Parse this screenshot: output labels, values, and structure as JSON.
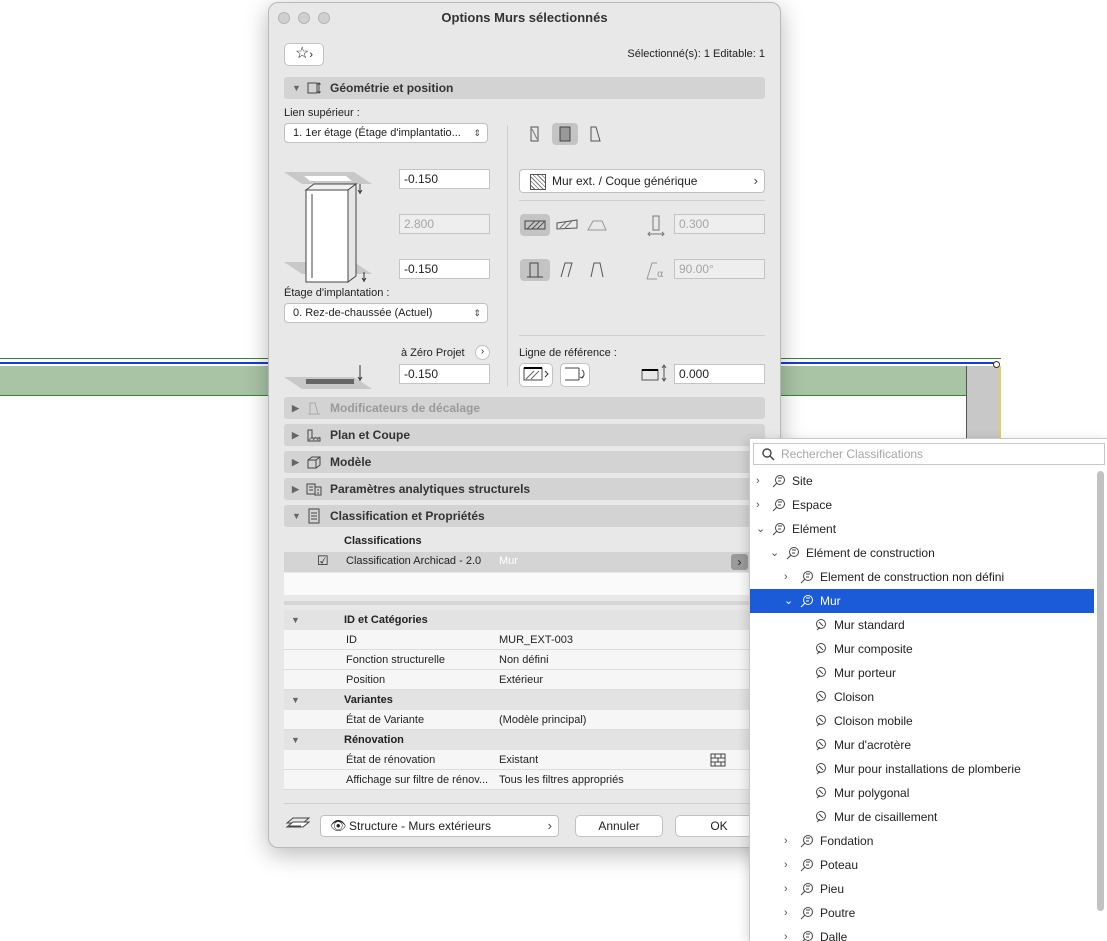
{
  "dialog": {
    "title": "Options Murs sélectionnés",
    "selection_info": "Sélectionné(s): 1 Editable: 1"
  },
  "geometry": {
    "header": "Géométrie et position",
    "top_link_label": "Lien supérieur :",
    "top_link_value": "1. 1er étage (Étage d'implantatio...",
    "top_offset": "-0.150",
    "height": "2.800",
    "bottom_offset": "-0.150",
    "home_story_label": "Étage d'implantation :",
    "home_story_value": "0. Rez-de-chaussée (Actuel)",
    "project_zero_label": "à Zéro Projet",
    "project_zero_value": "-0.150",
    "composite_value": "Mur ext. / Coque générique",
    "thickness": "0.300",
    "slant_angle": "90.00°",
    "reference_line_label": "Ligne de référence :",
    "reference_offset": "0.000"
  },
  "sections": {
    "offset_modifiers": "Modificateurs de décalage",
    "floor_plan": "Plan et Coupe",
    "model": "Modèle",
    "structural": "Paramètres analytiques structurels",
    "classification": "Classification et Propriétés"
  },
  "classifications": {
    "header": "Classifications",
    "system": "Classification Archicad - 2.0",
    "value": "Mur"
  },
  "properties": {
    "groups": [
      {
        "name": "ID et Catégories",
        "rows": [
          {
            "name": "ID",
            "value": "MUR_EXT-003"
          },
          {
            "name": "Fonction structurelle",
            "value": "Non défini"
          },
          {
            "name": "Position",
            "value": "Extérieur"
          }
        ]
      },
      {
        "name": "Variantes",
        "rows": [
          {
            "name": "État de Variante",
            "value": "(Modèle principal)"
          }
        ]
      },
      {
        "name": "Rénovation",
        "rows": [
          {
            "name": "État de rénovation",
            "value": "Existant"
          },
          {
            "name": "Affichage sur filtre de rénov...",
            "value": "Tous les filtres appropriés"
          }
        ]
      }
    ]
  },
  "footer": {
    "layer": "Structure - Murs extérieurs",
    "cancel": "Annuler",
    "ok": "OK"
  },
  "tree": {
    "search_placeholder": "Rechercher Classifications",
    "nodes": [
      {
        "label": "Site"
      },
      {
        "label": "Espace"
      },
      {
        "label": "Elément"
      },
      {
        "label": "Elément de construction"
      },
      {
        "label": "Element de construction non défini"
      },
      {
        "label": "Mur"
      },
      {
        "label": "Mur standard"
      },
      {
        "label": "Mur composite"
      },
      {
        "label": "Mur porteur"
      },
      {
        "label": "Cloison"
      },
      {
        "label": "Cloison mobile"
      },
      {
        "label": "Mur d'acrotère"
      },
      {
        "label": "Mur pour installations de plomberie"
      },
      {
        "label": "Mur polygonal"
      },
      {
        "label": "Mur de cisaillement"
      },
      {
        "label": "Fondation"
      },
      {
        "label": "Poteau"
      },
      {
        "label": "Pieu"
      },
      {
        "label": "Poutre"
      },
      {
        "label": "Dalle"
      }
    ]
  },
  "colors": {
    "wall_fill": "#a9c3a5",
    "wall_outline_blue": "#1b3bd6",
    "wall_outline_green": "#2e8b2e",
    "selection_blue": "#1b5bd8"
  }
}
